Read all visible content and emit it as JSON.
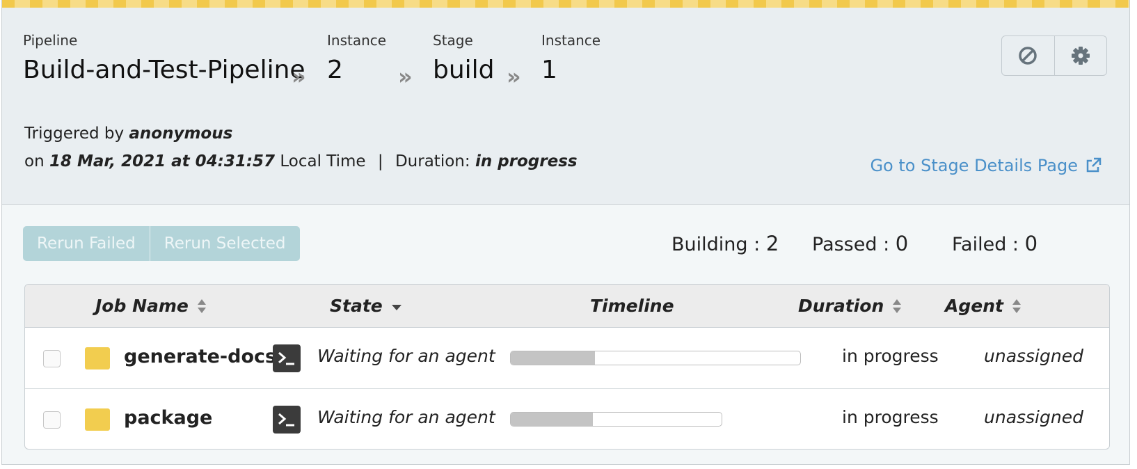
{
  "breadcrumb": [
    {
      "label": "Pipeline",
      "value": "Build-and-Test-Pipeline"
    },
    {
      "label": "Instance",
      "value": "2"
    },
    {
      "label": "Stage",
      "value": "build"
    },
    {
      "label": "Instance",
      "value": "1"
    }
  ],
  "separator": "»",
  "toolbar": {
    "cancel_icon": "cancel-icon",
    "settings_icon": "gear-icon"
  },
  "trigger": {
    "triggered_by_prefix": "Triggered by",
    "user": "anonymous",
    "on_prefix": "on",
    "datetime": "18 Mar, 2021 at 04:31:57",
    "time_suffix": "Local Time",
    "divider": "|",
    "duration_label": "Duration:",
    "duration_value": "in progress"
  },
  "stage_link": {
    "label": "Go to Stage Details Page",
    "icon": "external-link-icon"
  },
  "actions": {
    "rerun_failed": "Rerun Failed",
    "rerun_selected": "Rerun Selected"
  },
  "counts": {
    "building_label": "Building :",
    "building": "2",
    "passed_label": "Passed :",
    "passed": "0",
    "failed_label": "Failed :",
    "failed": "0"
  },
  "table": {
    "headers": {
      "job_name": "Job Name",
      "state": "State",
      "timeline": "Timeline",
      "duration": "Duration",
      "agent": "Agent"
    },
    "rows": [
      {
        "name": "generate-docs",
        "state": "Waiting for an agent",
        "progress": 0.29,
        "duration": "in progress",
        "agent": "unassigned"
      },
      {
        "name": "package",
        "state": "Waiting for an agent",
        "progress": 0.39,
        "duration": "in progress",
        "agent": "unassigned"
      }
    ]
  },
  "colors": {
    "accent": "#f2c94c",
    "link": "#4a90c9",
    "job_status": "#f2cd4f"
  }
}
